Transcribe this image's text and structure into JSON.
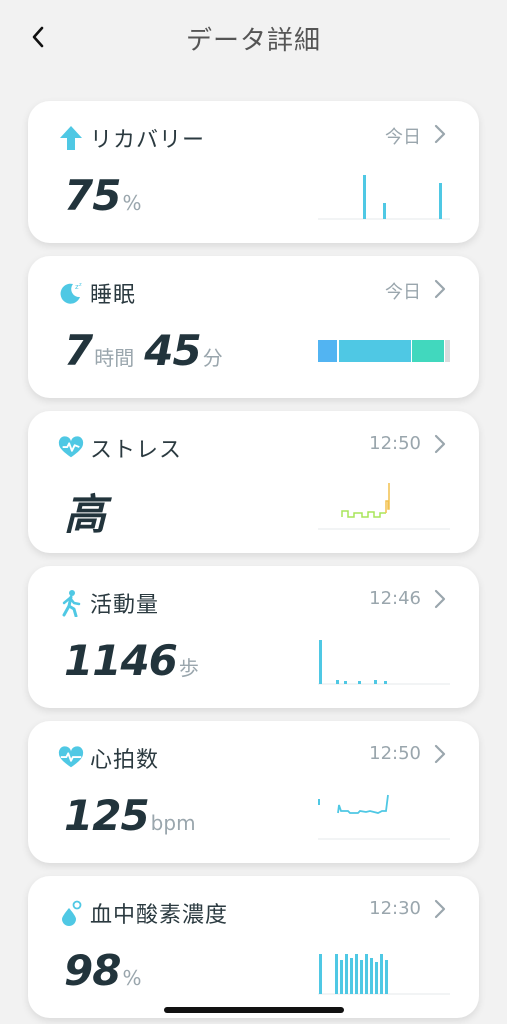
{
  "header": {
    "title": "データ詳細"
  },
  "colors": {
    "accent": "#4fc8e4",
    "teal": "#41d8be",
    "blue": "#52b4f2",
    "lime": "#a8e55a",
    "gold": "#f2c14e"
  },
  "cards": [
    {
      "name": "recovery",
      "label": "リカバリー",
      "time": "今日",
      "value": "75",
      "unit": "%"
    },
    {
      "name": "sleep",
      "label": "睡眠",
      "time": "今日",
      "value_hours": "7",
      "unit_hours": "時間",
      "value_minutes": "45",
      "unit_minutes": "分"
    },
    {
      "name": "stress",
      "label": "ストレス",
      "time": "12:50",
      "value": "高"
    },
    {
      "name": "activity",
      "label": "活動量",
      "time": "12:46",
      "value": "1146",
      "unit": "歩"
    },
    {
      "name": "heart-rate",
      "label": "心拍数",
      "time": "12:50",
      "value": "125",
      "unit": "bpm"
    },
    {
      "name": "spo2",
      "label": "血中酸素濃度",
      "time": "12:30",
      "value": "98",
      "unit": "%"
    }
  ]
}
